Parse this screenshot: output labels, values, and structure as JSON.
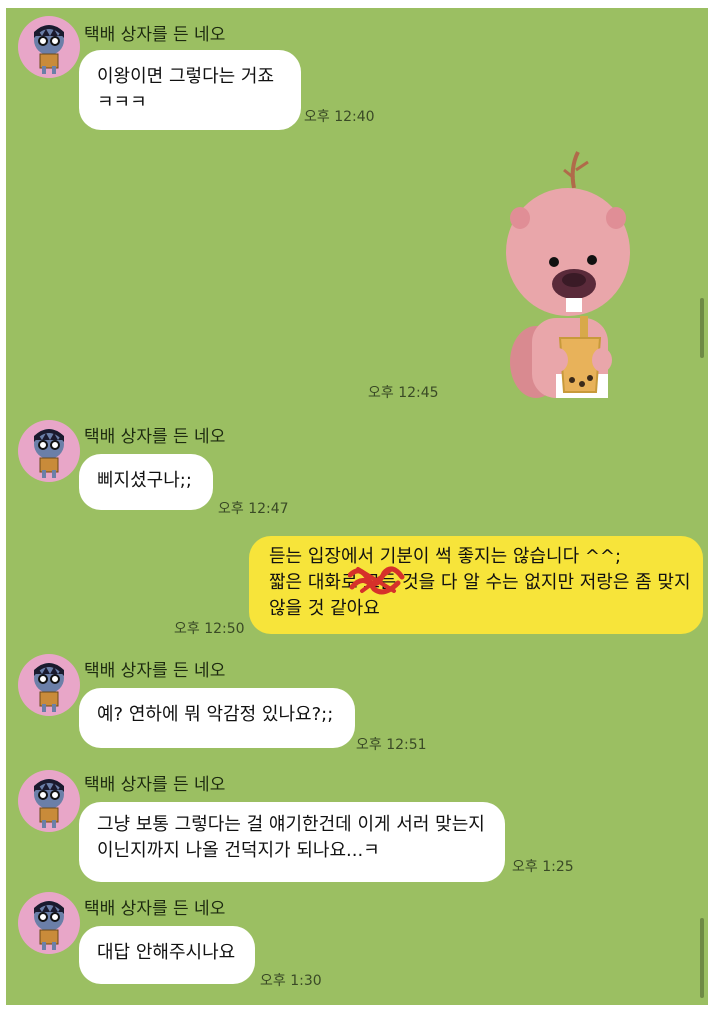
{
  "sender_name": "택배 상자를 든 네오",
  "messages": [
    {
      "lines": [
        "이왕이면 그렇다는 거죠",
        "ㅋㅋㅋ"
      ],
      "time": "오후 12:40"
    },
    {
      "sticker": "beaver-drinking-sticker",
      "time": "오후 12:45"
    },
    {
      "lines": [
        "삐지셨구나;;"
      ],
      "time": "오후 12:47"
    },
    {
      "lines": [
        "듣는 입장에서 기분이 썩 좋지는 않습니다 ^^;",
        "짧은 대화로 모든 것을 다 알 수는 없지만 저랑은 좀 맞지",
        "않을 것 같아요"
      ],
      "time": "오후 12:50"
    },
    {
      "lines": [
        "예? 연하에 뭐 악감정 있나요?;;"
      ],
      "time": "오후 12:51"
    },
    {
      "lines": [
        "그냥 보통 그렇다는 걸 얘기한건데 이게 서러 맞는지",
        "이닌지까지 나올 건덕지가 되나요...ㅋ"
      ],
      "time": "오후 1:25"
    },
    {
      "lines": [
        "대답 안해주시나요"
      ],
      "time": "오후 1:30"
    }
  ],
  "colors": {
    "background": "#9bbf62",
    "incoming_bubble": "#ffffff",
    "outgoing_bubble": "#f7e43a",
    "avatar_bg": "#e8a6c8"
  }
}
